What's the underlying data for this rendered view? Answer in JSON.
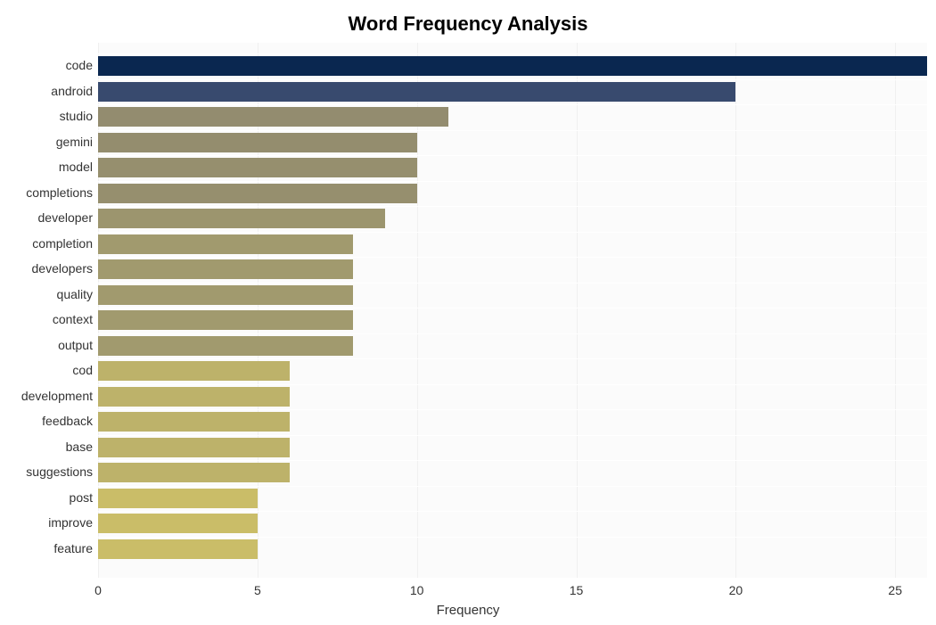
{
  "chart_data": {
    "type": "bar",
    "orientation": "horizontal",
    "title": "Word Frequency Analysis",
    "xlabel": "Frequency",
    "ylabel": "",
    "xlim": [
      0,
      26
    ],
    "xticks": [
      0,
      5,
      10,
      15,
      20,
      25
    ],
    "categories": [
      "code",
      "android",
      "studio",
      "gemini",
      "model",
      "completions",
      "developer",
      "completion",
      "developers",
      "quality",
      "context",
      "output",
      "cod",
      "development",
      "feedback",
      "base",
      "suggestions",
      "post",
      "improve",
      "feature"
    ],
    "values": [
      26,
      20,
      11,
      10,
      10,
      10,
      9,
      8,
      8,
      8,
      8,
      8,
      6,
      6,
      6,
      6,
      6,
      5,
      5,
      5
    ],
    "colors": [
      "#0a2750",
      "#384a6e",
      "#938c6f",
      "#948d6e",
      "#968f6e",
      "#968f6e",
      "#9c956e",
      "#a19a6e",
      "#a19a6e",
      "#a19a6e",
      "#a19a6e",
      "#a19a6e",
      "#bdb26a",
      "#bdb26a",
      "#bdb26a",
      "#bdb26a",
      "#bdb26a",
      "#cabd68",
      "#cabd68",
      "#cabd68"
    ]
  }
}
